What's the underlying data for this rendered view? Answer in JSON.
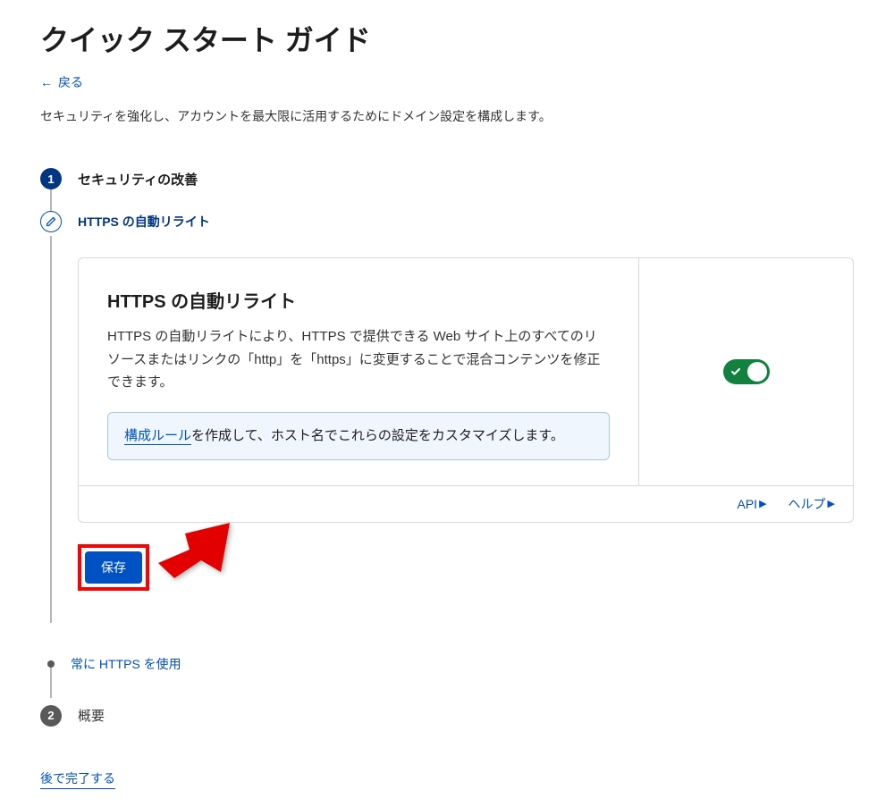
{
  "page": {
    "title": "クイック スタート ガイド",
    "back_label": "戻る",
    "subtitle": "セキュリティを強化し、アカウントを最大限に活用するためにドメイン設定を構成します。"
  },
  "step1": {
    "number": "1",
    "title": "セキュリティの改善",
    "sub_label": "HTTPS の自動リライト"
  },
  "card": {
    "title": "HTTPS の自動リライト",
    "description": "HTTPS の自動リライトにより、HTTPS で提供できる Web サイト上のすべてのリソースまたはリンクの「http」を「https」に変更することで混合コンテンツを修正できます。",
    "info_link": "構成ルール",
    "info_rest": "を作成して、ホスト名でこれらの設定をカスタマイズします。",
    "api_label": "API",
    "help_label": "ヘルプ"
  },
  "save_label": "保存",
  "always_https_label": "常に HTTPS を使用",
  "step2": {
    "number": "2",
    "title": "概要"
  },
  "later_label": "後で完了する"
}
